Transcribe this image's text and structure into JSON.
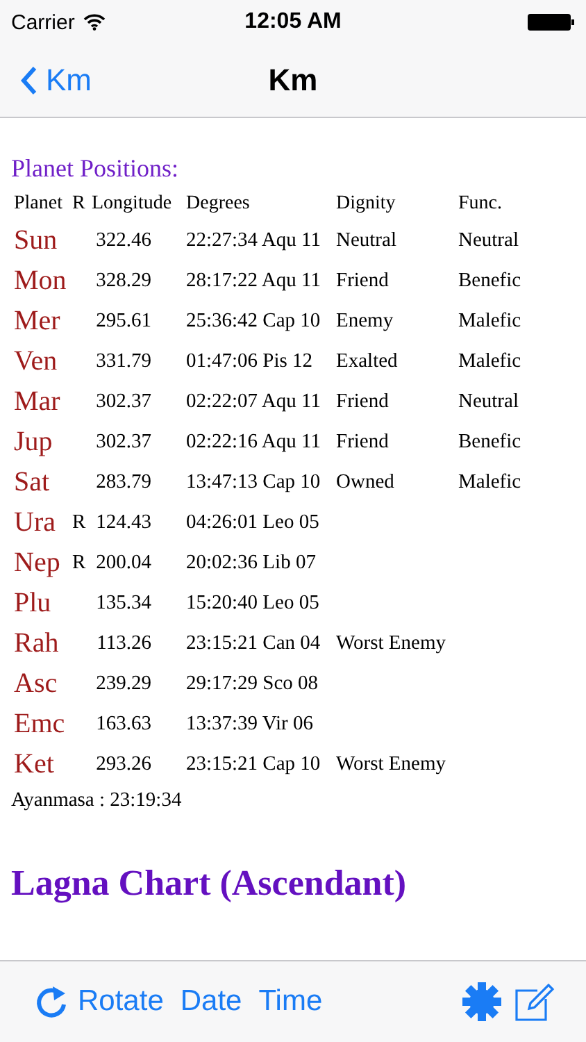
{
  "status_bar": {
    "carrier": "Carrier",
    "time": "12:05 AM"
  },
  "nav": {
    "back": "Km",
    "title": "Km"
  },
  "section_title": "Planet Positions:",
  "table": {
    "columns": [
      "Planet",
      "R",
      "Longitude",
      "Degrees",
      "Dignity",
      "Func."
    ],
    "rows": [
      {
        "planet": "Sun",
        "longitude": "322.46",
        "degrees": "22:27:34 Aqu 11",
        "dignity": "Neutral",
        "func": "Neutral"
      },
      {
        "planet": "Mon",
        "longitude": "328.29",
        "degrees": "28:17:22 Aqu 11",
        "dignity": "Friend",
        "func": "Benefic"
      },
      {
        "planet": "Mer",
        "longitude": "295.61",
        "degrees": "25:36:42 Cap 10",
        "dignity": "Enemy",
        "func": "Malefic"
      },
      {
        "planet": "Ven",
        "longitude": "331.79",
        "degrees": "01:47:06 Pis 12",
        "dignity": "Exalted",
        "func": "Malefic"
      },
      {
        "planet": "Mar",
        "longitude": "302.37",
        "degrees": "02:22:07 Aqu 11",
        "dignity": "Friend",
        "func": "Neutral"
      },
      {
        "planet": "Jup",
        "longitude": "302.37",
        "degrees": "02:22:16 Aqu 11",
        "dignity": "Friend",
        "func": "Benefic"
      },
      {
        "planet": "Sat",
        "longitude": "283.79",
        "degrees": "13:47:13 Cap 10",
        "dignity": "Owned",
        "func": "Malefic"
      },
      {
        "planet": "Ura",
        "retro": "R",
        "longitude": "124.43",
        "degrees": "04:26:01 Leo 05"
      },
      {
        "planet": "Nep",
        "retro": "R",
        "longitude": "200.04",
        "degrees": "20:02:36 Lib 07"
      },
      {
        "planet": "Plu",
        "longitude": "135.34",
        "degrees": "15:20:40 Leo 05"
      },
      {
        "planet": "Rah",
        "longitude": "113.26",
        "degrees": "23:15:21 Can 04",
        "dignity": "Worst Enemy"
      },
      {
        "planet": "Asc",
        "longitude": "239.29",
        "degrees": "29:17:29 Sco 08"
      },
      {
        "planet": "Emc",
        "longitude": "163.63",
        "degrees": "13:37:39 Vir 06"
      },
      {
        "planet": "Ket",
        "longitude": "293.26",
        "degrees": "23:15:21 Cap 10",
        "dignity": "Worst Enemy"
      }
    ]
  },
  "ayanamsa": "Ayanmasa : 23:19:34",
  "chart_title": "Lagna Chart (Ascendant)",
  "toolbar": [
    "Rotate",
    "Date",
    "Time"
  ]
}
